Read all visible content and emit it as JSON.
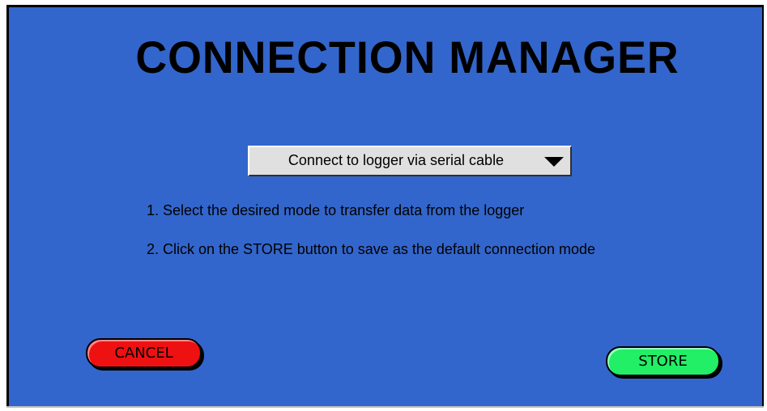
{
  "window": {
    "title": "CONNECTION MANAGER",
    "background_color": "#3366cc"
  },
  "connection_mode": {
    "selected": "Connect to logger via serial cable",
    "icon": "dropdown-arrow-icon"
  },
  "instructions": [
    "1.  Select the desired mode to transfer data from the logger",
    "2.  Click on the STORE button to save as the default connection mode"
  ],
  "buttons": {
    "cancel_label": "CANCEL",
    "cancel_color": "#ee1111",
    "store_label": "STORE",
    "store_color": "#22ee66"
  }
}
